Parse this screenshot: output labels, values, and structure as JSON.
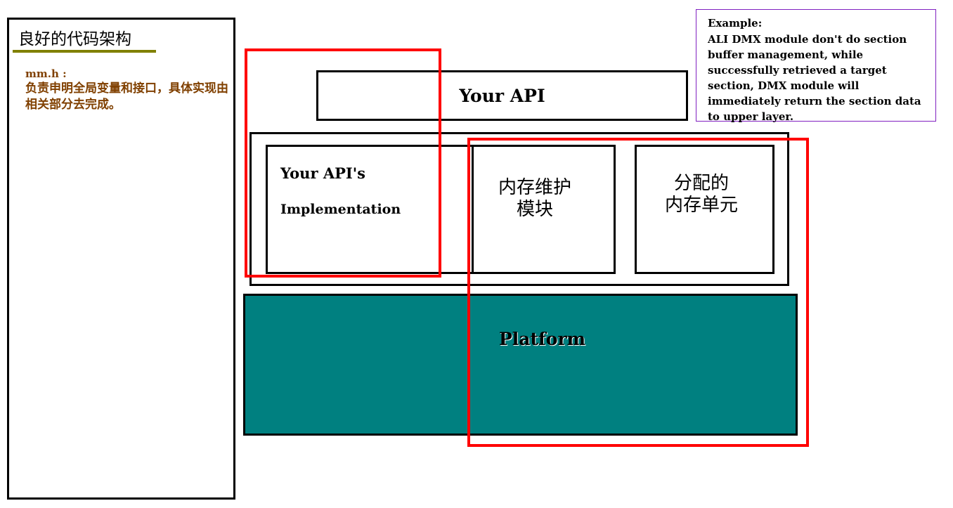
{
  "left_panel": {
    "title": "良好的代码架构",
    "file_label": "mm.h :",
    "description": "负责申明全局变量和接口，具体实现由相关部分去完成。"
  },
  "example": {
    "title": "Example:",
    "text": "ALI DMX module don't do section buffer management, while successfully retrieved a target section, DMX module will immediately return the section data to upper layer."
  },
  "diagram": {
    "your_api": "Your API",
    "implementation_line1": "Your API's",
    "implementation_line2": "Implementation",
    "memory_maintenance": "内存维护\n模块",
    "memory_unit": "分配的\n内存单元",
    "platform": "Platform"
  },
  "colors": {
    "platform_fill": "#008080",
    "highlight": "#ff0000",
    "underline": "#808000",
    "desc_text": "#804000",
    "example_border": "#8020c0"
  }
}
